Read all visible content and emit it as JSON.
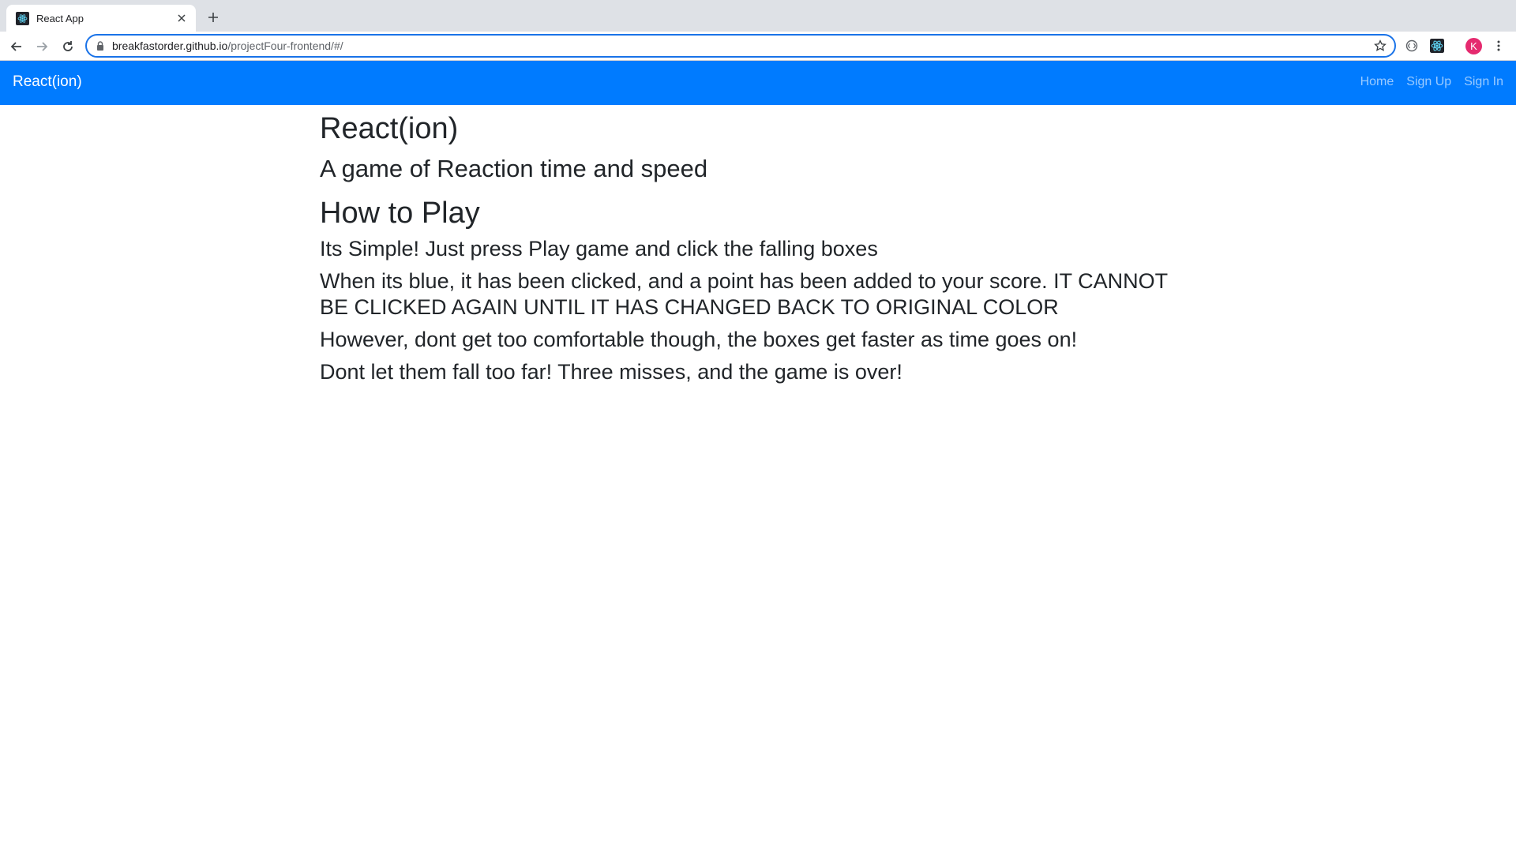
{
  "browser": {
    "tab_title": "React App",
    "url_host": "breakfastorder.github.io",
    "url_path": "/projectFour-frontend/#/",
    "profile_initial": "K"
  },
  "navbar": {
    "brand": "React(ion)",
    "links": [
      "Home",
      "Sign Up",
      "Sign In"
    ],
    "color": "#007bff"
  },
  "content": {
    "title": "React(ion)",
    "subtitle": "A game of Reaction time and speed",
    "how_heading": "How to Play",
    "lines": [
      "Its Simple! Just press Play game and click the falling boxes",
      "When its blue, it has been clicked, and a point has been added to your score. IT CANNOT BE CLICKED AGAIN UNTIL IT HAS CHANGED BACK TO ORIGINAL COLOR",
      "However, dont get too comfortable though, the boxes get faster as time goes on!",
      "Dont let them fall too far! Three misses, and the game is over!"
    ]
  }
}
